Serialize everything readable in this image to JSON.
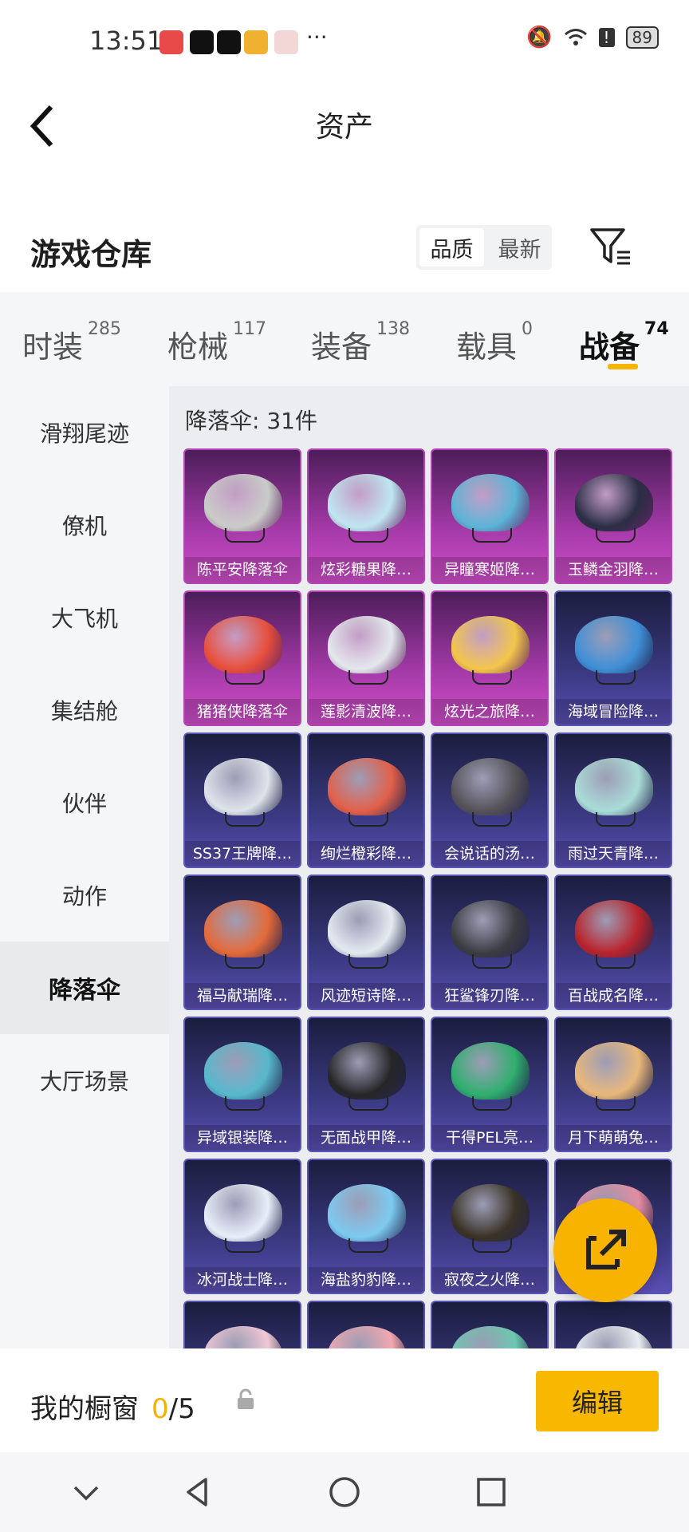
{
  "status": {
    "time": "13:51",
    "more": "···",
    "battery": "89"
  },
  "page": {
    "title": "资产"
  },
  "section": {
    "title": "游戏仓库",
    "sort_quality": "品质",
    "sort_newest": "最新"
  },
  "tabs": [
    {
      "label": "时装",
      "count": "285"
    },
    {
      "label": "枪械",
      "count": "117"
    },
    {
      "label": "装备",
      "count": "138"
    },
    {
      "label": "载具",
      "count": "0"
    },
    {
      "label": "战备",
      "count": "74"
    }
  ],
  "nav": [
    "滑翔尾迹",
    "僚机",
    "大飞机",
    "集结舱",
    "伙伴",
    "动作",
    "降落伞",
    "大厅场景"
  ],
  "nav_active_index": 6,
  "content": {
    "heading": "降落伞: 31件"
  },
  "items": [
    {
      "name": "陈平安降落伞",
      "rarity": "purple",
      "color": "#c9ccc8"
    },
    {
      "name": "炫彩糖果降…",
      "rarity": "purple",
      "color": "#bfe6f0"
    },
    {
      "name": "异瞳寒姬降…",
      "rarity": "purple",
      "color": "#5bb4d6"
    },
    {
      "name": "玉鳞金羽降…",
      "rarity": "purple",
      "color": "#2a2e44"
    },
    {
      "name": "猪猪侠降落伞",
      "rarity": "purple",
      "color": "#e84f3c"
    },
    {
      "name": "莲影清波降…",
      "rarity": "purple",
      "color": "#e3e8ec"
    },
    {
      "name": "炫光之旅降…",
      "rarity": "purple",
      "color": "#f2c64a"
    },
    {
      "name": "海域冒险降…",
      "rarity": "blue",
      "color": "#3f8fd6"
    },
    {
      "name": "SS37王牌降…",
      "rarity": "blue",
      "color": "#dfe3ea"
    },
    {
      "name": "绚烂橙彩降…",
      "rarity": "blue",
      "color": "#e2604a"
    },
    {
      "name": "会说话的汤…",
      "rarity": "blue",
      "color": "#555258"
    },
    {
      "name": "雨过天青降…",
      "rarity": "blue",
      "color": "#a9dcd6"
    },
    {
      "name": "福马献瑞降…",
      "rarity": "blue",
      "color": "#e46a3a"
    },
    {
      "name": "风迹短诗降…",
      "rarity": "blue",
      "color": "#e4eaf0"
    },
    {
      "name": "狂鲨锋刃降…",
      "rarity": "blue",
      "color": "#3c3c42"
    },
    {
      "name": "百战成名降…",
      "rarity": "blue",
      "color": "#b8242c"
    },
    {
      "name": "异域银装降…",
      "rarity": "blue",
      "color": "#57b8cc"
    },
    {
      "name": "无面战甲降…",
      "rarity": "blue",
      "color": "#262628"
    },
    {
      "name": "干得PEL亮…",
      "rarity": "blue",
      "color": "#2fae6e"
    },
    {
      "name": "月下萌萌兔…",
      "rarity": "blue",
      "color": "#e8b87a"
    },
    {
      "name": "冰河战士降…",
      "rarity": "blue",
      "color": "#e8eef8"
    },
    {
      "name": "海盐豹豹降…",
      "rarity": "blue",
      "color": "#7ccaf0"
    },
    {
      "name": "寂夜之火降…",
      "rarity": "blue",
      "color": "#3a3226"
    },
    {
      "name": "",
      "rarity": "blue",
      "color": "#e48ca0"
    },
    {
      "name": "",
      "rarity": "blue",
      "color": "#f0c8d4"
    },
    {
      "name": "",
      "rarity": "blue",
      "color": "#f2a8b0"
    },
    {
      "name": "",
      "rarity": "blue",
      "color": "#6cc8b0"
    },
    {
      "name": "",
      "rarity": "blue",
      "color": "#e8ecf0"
    }
  ],
  "bottom": {
    "label": "我的橱窗",
    "current": "0",
    "total": "/5",
    "edit": "编辑"
  }
}
